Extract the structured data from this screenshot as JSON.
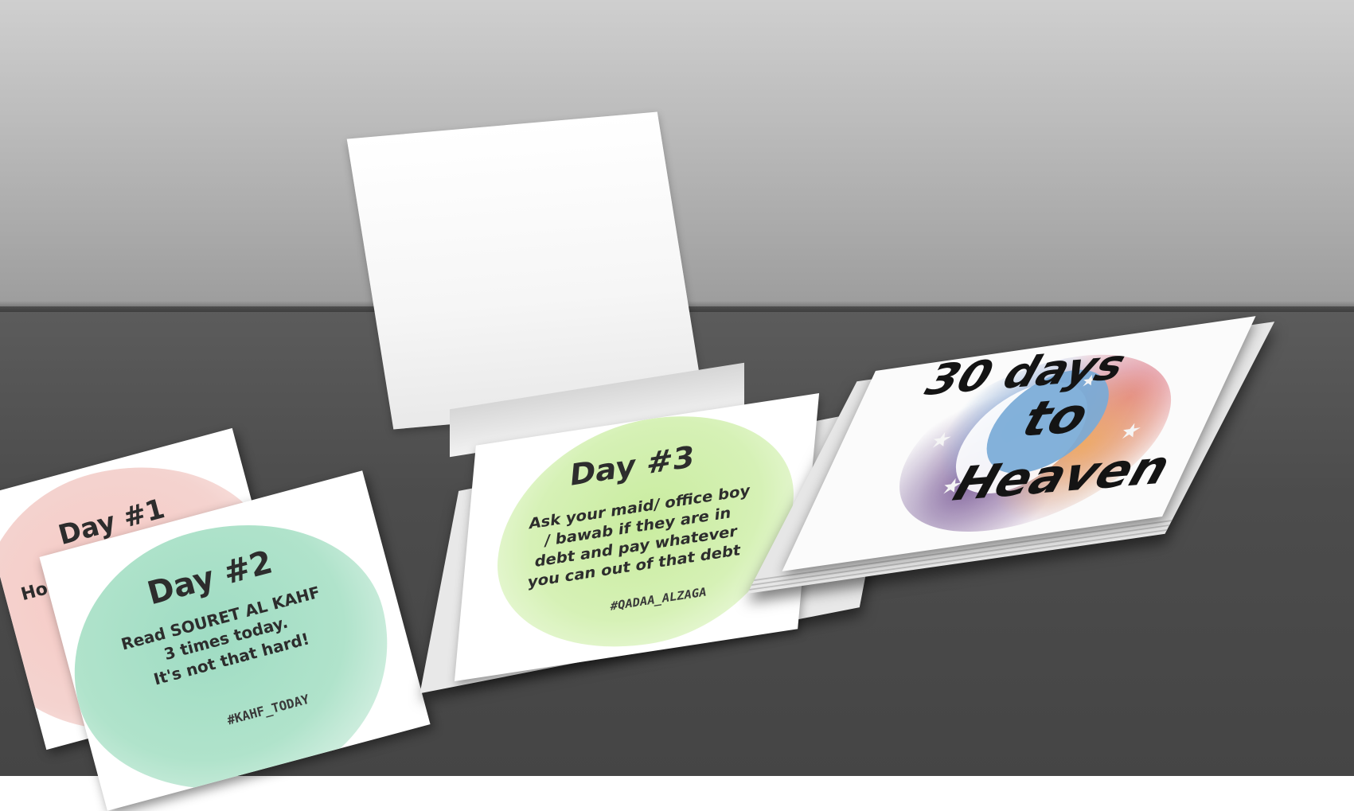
{
  "scene": {
    "colors": {
      "wall": "#bdbdbd",
      "table": "#4c4c4c",
      "pink_wash": "#f4d3cf",
      "mint_wash": "#b0e3cb",
      "lime_wash": "#d6f1b6"
    }
  },
  "cards": {
    "day1": {
      "title": "Day #1",
      "text": "Hold your"
    },
    "day2": {
      "title": "Day #2",
      "lines": [
        "Read SOURET AL KAHF",
        "3 times today.",
        "It's not that hard!"
      ],
      "tag": "#KAHF_TODAY"
    },
    "day3": {
      "title": "Day #3",
      "lines": [
        "Ask your maid/ office boy",
        "/ bawab if they are in",
        "debt and pay whatever",
        "you can out of that debt"
      ],
      "tag": "#QADAA_ALZAGA"
    }
  },
  "cover": {
    "title_lines": [
      "30 days",
      "to",
      "Heaven"
    ],
    "icons": [
      "crescent-moon-icon",
      "star-icon"
    ]
  }
}
